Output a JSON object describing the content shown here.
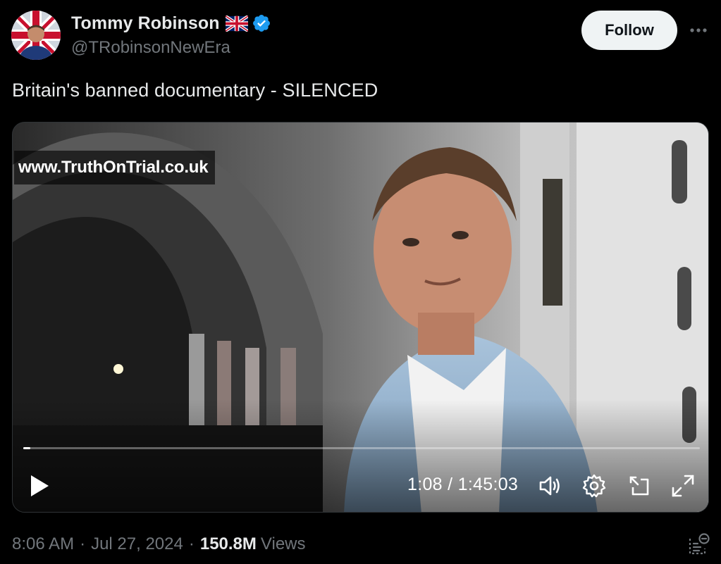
{
  "author": {
    "display_name": "Tommy Robinson",
    "handle": "@TRobinsonNewEra",
    "flag_icon": "uk-flag-emoji",
    "verified_icon": "verified-badge-icon",
    "verified_color": "#1d9bf0"
  },
  "actions": {
    "follow_label": "Follow",
    "more_icon": "more-horizontal-icon"
  },
  "post": {
    "text": "Britain's banned documentary - SILENCED"
  },
  "video": {
    "watermark": "www.TruthOnTrial.co.uk",
    "current_time": "1:08",
    "duration": "1:45:03",
    "time_separator": " / ",
    "progress_fraction": 0.0108,
    "play_icon": "play-icon",
    "volume_icon": "volume-icon",
    "settings_icon": "settings-gear-icon",
    "dock_icon": "picture-in-picture-icon",
    "fullscreen_icon": "fullscreen-expand-icon"
  },
  "meta": {
    "time": "8:06 AM",
    "date": "Jul 27, 2024",
    "separator": "·",
    "views_count": "150.8M",
    "views_label": "Views",
    "analytics_icon": "analytics-icon"
  },
  "colors": {
    "background": "#000000",
    "text_primary": "#e7e9ea",
    "text_secondary": "#71767b",
    "follow_bg": "#eff3f4",
    "follow_text": "#0f1419"
  }
}
